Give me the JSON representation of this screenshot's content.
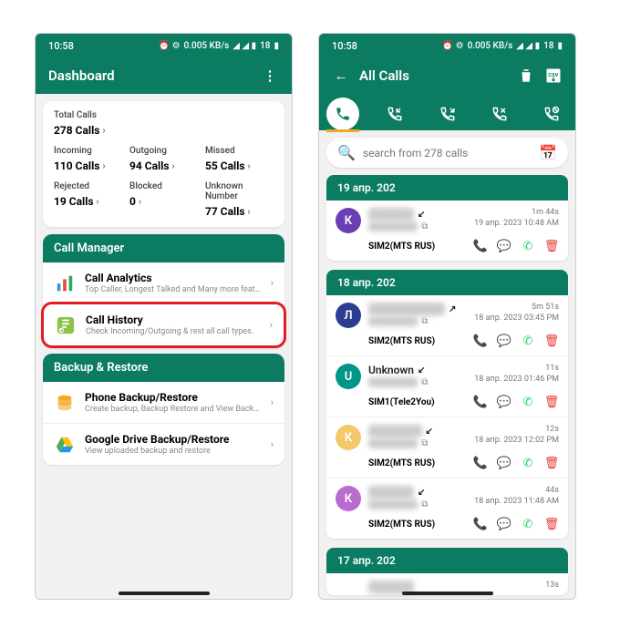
{
  "status": {
    "time": "10:58",
    "net": "0.005 KB/s",
    "battery": "18"
  },
  "left": {
    "title": "Dashboard",
    "total_label": "Total Calls",
    "total_value": "278 Calls",
    "incoming_label": "Incoming",
    "incoming_value": "110 Calls",
    "outgoing_label": "Outgoing",
    "outgoing_value": "94 Calls",
    "missed_label": "Missed",
    "missed_value": "55 Calls",
    "rejected_label": "Rejected",
    "rejected_value": "19 Calls",
    "blocked_label": "Blocked",
    "blocked_value": "0",
    "unknown_label": "Unknown Number",
    "unknown_value": "77 Calls",
    "call_manager": "Call Manager",
    "analytics_title": "Call Analytics",
    "analytics_sub": "Top Caller, Longest Talked and Many more features",
    "history_title": "Call History",
    "history_sub": "Check Incoming/Outgoing & rest all call types.",
    "backup_restore": "Backup & Restore",
    "phone_backup_title": "Phone Backup/Restore",
    "phone_backup_sub": "Create backup, Backup Restore and View Backup",
    "gdrive_title": "Google Drive Backup/Restore",
    "gdrive_sub": "View uploaded backup and restore"
  },
  "right": {
    "title": "All Calls",
    "search_placeholder": "search from 278 calls",
    "dates": {
      "d1": "19 апр. 202",
      "d2": "18 апр. 202",
      "d3": "17 апр. 202"
    },
    "rows": [
      {
        "initial": "К",
        "color": "#6a3fb5",
        "dir": "↙",
        "dur": "1m 44s",
        "ts": "19 апр. 2023 10:48 AM",
        "sim": "SIM2(MTS RUS)"
      },
      {
        "initial": "Л",
        "color": "#2c3e8f",
        "dir": "↗",
        "dur": "5m 51s",
        "ts": "18 апр. 2023 03:45 PM",
        "sim": "SIM2(MTS RUS)"
      },
      {
        "initial": "U",
        "color": "#009688",
        "name": "Unknown",
        "dir": "↙",
        "dur": "11s",
        "ts": "18 апр. 2023 01:46 PM",
        "sim": "SIM1(Tele2You)"
      },
      {
        "initial": "К",
        "color": "#f2c96b",
        "dir": "↙",
        "dur": "12s",
        "ts": "18 апр. 2023 12:02 PM",
        "sim": "SIM2(MTS RUS)"
      },
      {
        "initial": "К",
        "color": "#b96bd0",
        "dir": "↙",
        "dur": "44s",
        "ts": "18 апр. 2023 11:48 AM",
        "sim": "SIM2(MTS RUS)"
      },
      {
        "dur": "13s"
      }
    ]
  }
}
